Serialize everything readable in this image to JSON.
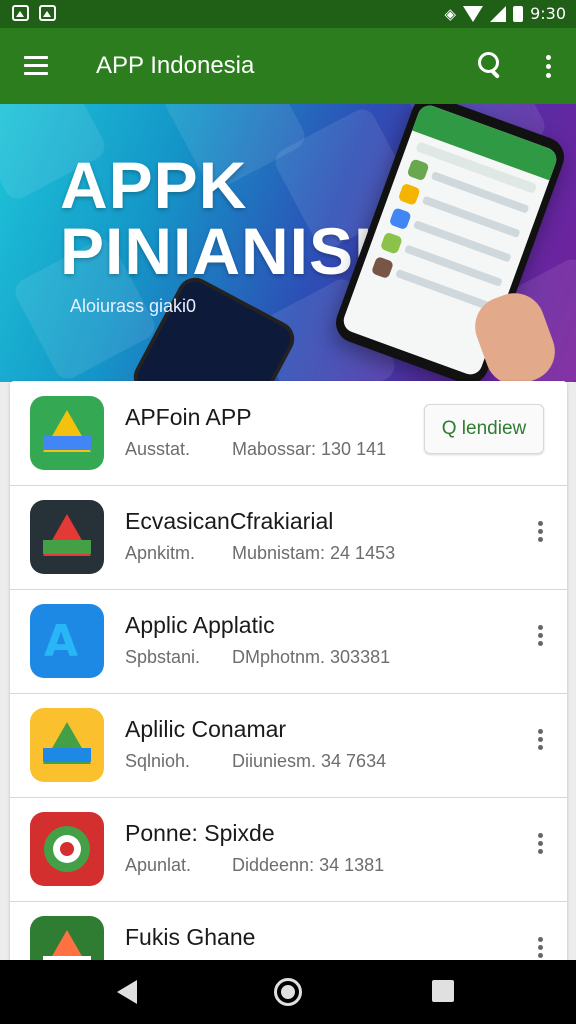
{
  "status_bar": {
    "time": "9:30"
  },
  "app_bar": {
    "title": "APP Indonesia"
  },
  "banner": {
    "title_line1": "APPK",
    "title_line2": "PINIANISI",
    "subtitle": "Aloiurass giaki0"
  },
  "apps": [
    {
      "title": "APFoin APP",
      "sub_a": "Ausstat.",
      "sub_b": "Mabossar: 130 141",
      "action": "install",
      "button_label": "Q lendiew",
      "icon": "drive-icon",
      "colors": [
        "#34a853",
        "#f4c20d",
        "#4285f4"
      ]
    },
    {
      "title": "EcvasicanCfrakiarial",
      "sub_a": "Apnkitm.",
      "sub_b": "Mubnistam: 24 1453",
      "action": "more",
      "icon": "drive-icon",
      "colors": [
        "#263238",
        "#e53935",
        "#43a047"
      ]
    },
    {
      "title": "Applic Applatic",
      "sub_a": "Spbstani.",
      "sub_b": "DMphotnm. 303381",
      "action": "more",
      "icon": "a-logo-icon",
      "colors": [
        "#1e88e5",
        "#29b6f6",
        "#0d47a1"
      ]
    },
    {
      "title": "Aplilic Conamar",
      "sub_a": "Sqlnioh.",
      "sub_b": "Diiuniesm. 34 7634",
      "action": "more",
      "icon": "drive-icon",
      "colors": [
        "#fbc02d",
        "#43a047",
        "#1e88e5"
      ]
    },
    {
      "title": "Ponne: Spixde",
      "sub_a": "Apunlat.",
      "sub_b": "Diddeenn: 34 1381",
      "action": "more",
      "icon": "target-icon",
      "colors": [
        "#d32f2f",
        "#43a047",
        "#ffffff"
      ]
    },
    {
      "title": "Fukis Ghane",
      "sub_a": "",
      "sub_b": "",
      "action": "more",
      "icon": "drive-icon",
      "colors": [
        "#2e7d32",
        "#ff7043",
        "#ffffff"
      ]
    }
  ]
}
